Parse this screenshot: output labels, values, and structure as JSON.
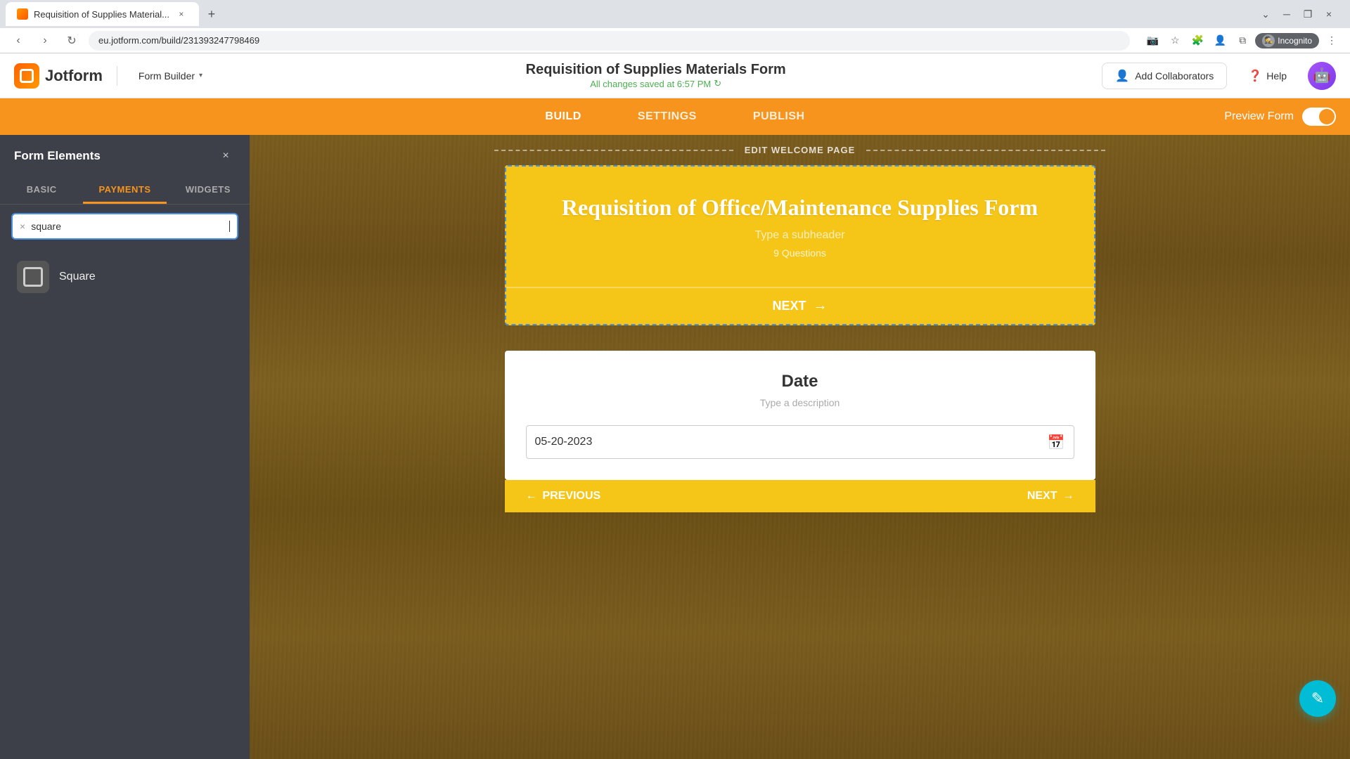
{
  "browser": {
    "tab_title": "Requisition of Supplies Material...",
    "url": "eu.jotform.com/build/231393247798469",
    "close_label": "×",
    "new_tab_label": "+",
    "minimize_label": "─",
    "maximize_label": "❐",
    "window_close_label": "×",
    "nav_down_label": "❮",
    "incognito_label": "Incognito"
  },
  "header": {
    "logo_text": "Jotform",
    "form_builder_label": "Form Builder",
    "form_title": "Requisition of Supplies Materials Form",
    "autosave_text": "All changes saved at 6:57 PM",
    "add_collaborators_label": "Add Collaborators",
    "help_label": "Help",
    "avatar_emoji": "🤖"
  },
  "nav": {
    "build_label": "BUILD",
    "settings_label": "SETTINGS",
    "publish_label": "PUBLISH",
    "preview_form_label": "Preview Form"
  },
  "left_panel": {
    "title": "Form Elements",
    "close_label": "×",
    "tabs": [
      {
        "label": "BASIC",
        "active": false
      },
      {
        "label": "PAYMENTS",
        "active": true
      },
      {
        "label": "WIDGETS",
        "active": false
      }
    ],
    "search_placeholder": "square",
    "search_value": "square",
    "results": [
      {
        "label": "Square"
      }
    ]
  },
  "canvas": {
    "edit_welcome_text": "EDIT WELCOME PAGE",
    "form_card": {
      "main_title": "Requisition of Office/Maintenance Supplies Form",
      "subheader_placeholder": "Type a subheader",
      "questions_count": "9  Questions",
      "next_label": "NEXT",
      "arrow": "→"
    },
    "date_card": {
      "title": "Date",
      "description": "Type a description",
      "value": "05-20-2023",
      "prev_label": "PREVIOUS",
      "next_label": "NEXT",
      "prev_arrow": "←",
      "next_arrow": "→"
    }
  }
}
